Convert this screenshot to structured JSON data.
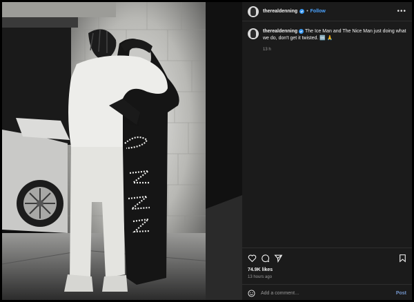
{
  "post": {
    "username": "therealdenning",
    "follow_label": "Follow",
    "separator": "•",
    "caption": "The Ice Man and The Nice Man just doing what we do, don't get it twisted. 🆒 🙏",
    "comment_time": "13 h",
    "likes": "74.9K likes",
    "posted_ago": "13 hours ago",
    "add_comment_placeholder": "Add a comment…",
    "post_label": "Post"
  },
  "colors": {
    "background": "#000000",
    "panel": "#1b1b1b",
    "link_blue": "#4ba3ff",
    "verified_blue": "#3897f0"
  },
  "icons": [
    "avatar",
    "verified-icon",
    "more-options-icon",
    "heart-icon",
    "comment-icon",
    "share-icon",
    "bookmark-icon",
    "emoji-icon"
  ]
}
